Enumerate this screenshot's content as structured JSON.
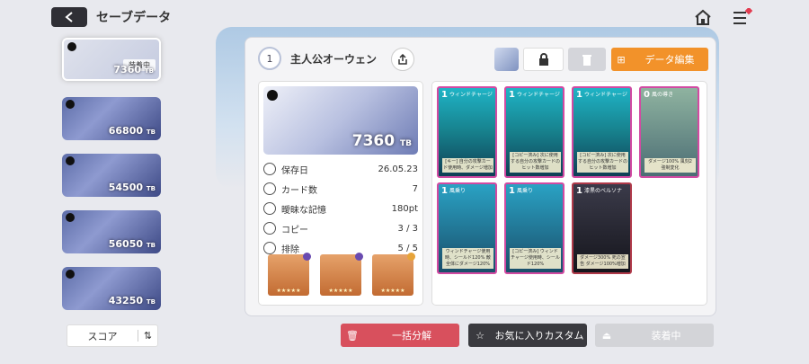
{
  "header": {
    "title": "セーブデータ"
  },
  "slots": [
    {
      "score": "7360",
      "unit": "TB",
      "badge": "装着中",
      "active": true
    },
    {
      "score": "66800",
      "unit": "TB"
    },
    {
      "score": "54500",
      "unit": "TB"
    },
    {
      "score": "56050",
      "unit": "TB"
    },
    {
      "score": "43250",
      "unit": "TB"
    }
  ],
  "sort": {
    "label": "スコア",
    "icon": "⇅"
  },
  "panel": {
    "level": "1",
    "name": "主人公オーウェン",
    "edit_label": "データ編集",
    "hero_score": "7360",
    "hero_unit": "TB",
    "stats": [
      {
        "key": "保存日",
        "value": "26.05.23"
      },
      {
        "key": "カード数",
        "value": "7"
      },
      {
        "key": "曖昧な記憶",
        "value": "180pt"
      },
      {
        "key": "コピー",
        "value": "3 / 3"
      },
      {
        "key": "排除",
        "value": "5 / 5"
      }
    ],
    "item_stars": "★★★★★"
  },
  "cards": [
    {
      "cost": "1",
      "name": "ウィンドチャージ",
      "text": "[キー] 自分の攻撃カード使用時、ダメージ増加"
    },
    {
      "cost": "1",
      "name": "ウィンドチャージ",
      "text": "[コピー済み] 次に使用する自分の攻撃カードのヒット数増加"
    },
    {
      "cost": "1",
      "name": "ウィンドチャージ",
      "text": "[コピー済み] 次に使用する自分の攻撃カードのヒット数増加"
    },
    {
      "cost": "0",
      "name": "風の導き",
      "text": "ダメージ100% 風刻2 強制変化"
    },
    {
      "cost": "1",
      "name": "風乗り",
      "text": "ウィンドチャージ使用時、シールド120% 敵全体にダメージ120%"
    },
    {
      "cost": "1",
      "name": "風乗り",
      "text": "[コピー済み] ウィンドチャージ使用時、シールド120%"
    },
    {
      "cost": "1",
      "name": "漆黒のベルソナ",
      "text": "ダメージ300% 死の宣告 ダメージ100%増加"
    }
  ],
  "bottom": {
    "bulk_label": "一括分解",
    "fav_label": "お気に入りカスタム",
    "equip_label": "装着中"
  }
}
